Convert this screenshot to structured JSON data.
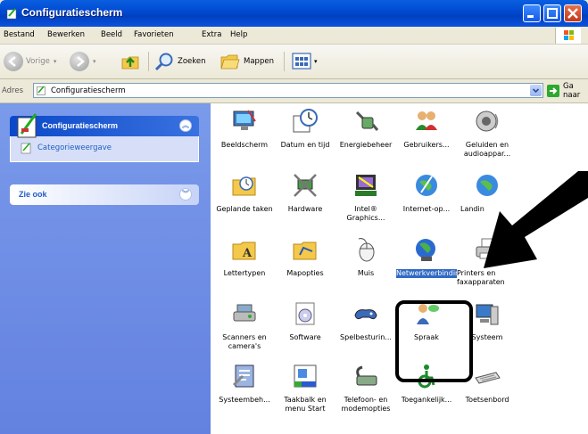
{
  "window": {
    "title": "Configuratiescherm"
  },
  "menu": [
    "Bestand",
    "Bewerken",
    "Beeld",
    "Favorieten",
    "Extra",
    "Help"
  ],
  "toolbar": {
    "back": "Vorige",
    "search": "Zoeken",
    "folders": "Mappen"
  },
  "address": {
    "label": "Adres",
    "value": "Configuratiescherm",
    "go": "Ga naar"
  },
  "sidebar": {
    "panel1": {
      "title": "Configuratiescherm",
      "link": "Categorieweergave"
    },
    "panel2": {
      "title": "Zie ook"
    }
  },
  "items": [
    {
      "label": "Beeldscherm",
      "icon": "display-icon"
    },
    {
      "label": "Datum en tijd",
      "icon": "clock-icon"
    },
    {
      "label": "Energiebeheer",
      "icon": "power-icon"
    },
    {
      "label": "Gebruikers...",
      "icon": "users-icon"
    },
    {
      "label": "Geluiden en audioappar...",
      "icon": "speaker-icon"
    },
    {
      "label": "Geplande taken",
      "icon": "scheduled-tasks-icon"
    },
    {
      "label": "Hardware",
      "icon": "hardware-icon"
    },
    {
      "label": "Intel® Graphics...",
      "icon": "intel-graphics-icon"
    },
    {
      "label": "Internet-op...",
      "icon": "internet-options-icon"
    },
    {
      "label": "Landin",
      "icon": "regional-settings-icon"
    },
    {
      "label": "Lettertypen",
      "icon": "fonts-icon"
    },
    {
      "label": "Mapopties",
      "icon": "folder-options-icon"
    },
    {
      "label": "Muis",
      "icon": "mouse-icon"
    },
    {
      "label": "Netwerkverbindingen",
      "icon": "network-icon",
      "selected": true
    },
    {
      "label": "Printers en faxapparaten",
      "icon": "printer-icon"
    },
    {
      "label": "Scanners en camera's",
      "icon": "scanner-icon"
    },
    {
      "label": "Software",
      "icon": "software-icon"
    },
    {
      "label": "Spelbesturin...",
      "icon": "game-controller-icon"
    },
    {
      "label": "Spraak",
      "icon": "speech-icon"
    },
    {
      "label": "Systeem",
      "icon": "system-icon"
    },
    {
      "label": "Systeembeh...",
      "icon": "admin-tools-icon"
    },
    {
      "label": "Taakbalk en menu Start",
      "icon": "taskbar-icon"
    },
    {
      "label": "Telefoon- en modemopties",
      "icon": "phone-icon"
    },
    {
      "label": "Toegankelijk...",
      "icon": "accessibility-icon"
    },
    {
      "label": "Toetsenbord",
      "icon": "keyboard-icon"
    }
  ]
}
